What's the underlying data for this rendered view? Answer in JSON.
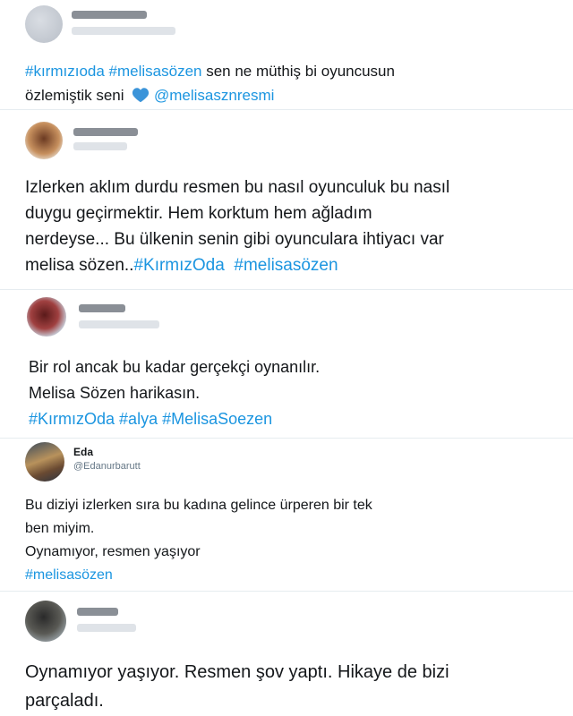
{
  "colors": {
    "link": "#1b95e0",
    "text": "#14171a",
    "secondary": "#657786",
    "heart": "#3b94d9"
  },
  "tweets": [
    {
      "id": "t1",
      "blurred_user": true,
      "lines": [
        [
          {
            "type": "tag",
            "text": "#kırmızıoda"
          },
          {
            "type": "text",
            "text": " "
          },
          {
            "type": "tag",
            "text": "#melisasözen"
          },
          {
            "type": "text",
            "text": " sen ne müthiş bi oyuncusun"
          }
        ],
        [
          {
            "type": "text",
            "text": "özlemiştik seni "
          },
          {
            "type": "icon",
            "icon": "blue-heart-icon"
          },
          {
            "type": "text",
            "text": " "
          },
          {
            "type": "mention",
            "text": "@melisasznresmi"
          }
        ]
      ]
    },
    {
      "id": "t2",
      "blurred_user": true,
      "lines": [
        [
          {
            "type": "text",
            "text": "Izlerken aklım durdu resmen bu nasıl oyunculuk bu nasıl"
          }
        ],
        [
          {
            "type": "text",
            "text": "duygu geçirmektir. Hem korktum hem ağladım"
          }
        ],
        [
          {
            "type": "text",
            "text": "nerdeyse... Bu ülkenin senin gibi oyunculara ihtiyacı var"
          }
        ],
        [
          {
            "type": "text",
            "text": "melisa sözen.."
          },
          {
            "type": "tag",
            "text": "#KırmızOda"
          },
          {
            "type": "text",
            "text": "  "
          },
          {
            "type": "tag",
            "text": "#melisasözen"
          }
        ]
      ]
    },
    {
      "id": "t3",
      "blurred_user": true,
      "lines": [
        [
          {
            "type": "text",
            "text": "Bir rol ancak bu kadar gerçekçi oynanılır."
          }
        ],
        [
          {
            "type": "text",
            "text": "Melisa Sözen harikasın."
          }
        ],
        [
          {
            "type": "tag",
            "text": "#KırmızOda"
          },
          {
            "type": "text",
            "text": " "
          },
          {
            "type": "tag",
            "text": "#alya"
          },
          {
            "type": "text",
            "text": " "
          },
          {
            "type": "tag",
            "text": "#MelisaSoezen"
          }
        ]
      ]
    },
    {
      "id": "t4",
      "blurred_user": false,
      "name": "Eda",
      "handle": "@Edanurbarutt",
      "lines": [
        [
          {
            "type": "text",
            "text": "Bu diziyi izlerken sıra bu kadına gelince ürperen bir tek"
          }
        ],
        [
          {
            "type": "text",
            "text": "ben miyim."
          }
        ],
        [
          {
            "type": "text",
            "text": "Oynamıyor, resmen yaşıyor"
          }
        ],
        [
          {
            "type": "tag",
            "text": "#melisasözen"
          }
        ]
      ]
    },
    {
      "id": "t5",
      "blurred_user": true,
      "lines": [
        [
          {
            "type": "text",
            "text": "Oynamıyor yaşıyor. Resmen şov yaptı. Hikaye de bizi"
          }
        ],
        [
          {
            "type": "text",
            "text": "parçaladı."
          }
        ]
      ]
    }
  ]
}
